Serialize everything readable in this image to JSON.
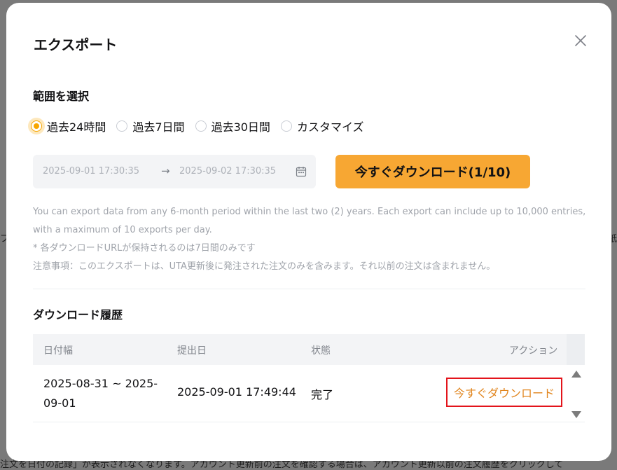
{
  "background": {
    "left_glyph": "フ",
    "right_glyph": "紙",
    "bottom_text": "注文を日付の記録」が表示されなくなります。アカウント更新前の注文を確認する場合は、アカウント更新以前の注文履歴をクリックして"
  },
  "modal": {
    "title": "エクスポート",
    "close_icon": "close-icon"
  },
  "range": {
    "label": "範囲を選択",
    "options": [
      {
        "label": "過去24時間",
        "checked": true
      },
      {
        "label": "過去7日間",
        "checked": false
      },
      {
        "label": "過去30日間",
        "checked": false
      },
      {
        "label": "カスタマイズ",
        "checked": false
      }
    ],
    "start": "2025-09-01 17:30:35",
    "arrow": "→",
    "end": "2025-09-02 17:30:35",
    "calendar_icon": "calendar-icon",
    "download_button": "今すぐダウンロード(1/10)"
  },
  "notes": [
    "You can export data from any 6-month period within the last two (2) years. Each export can include up to 10,000 entries,",
    "with a maximum of 10 exports per day.",
    "* 各ダウンロードURLが保持されるのは7日間のみです",
    "注意事項：このエクスポートは、UTA更新後に発注された注文のみを含みます。それ以前の注文は含まれません。"
  ],
  "history": {
    "label": "ダウンロード履歴",
    "columns": [
      "日付幅",
      "提出日",
      "状態",
      "アクション"
    ],
    "rows": [
      {
        "range_line1": "2025-08-31 ~ 2025-",
        "range_line2": "09-01",
        "submitted": "2025-09-01 17:49:44",
        "status": "完了",
        "action": "今すぐダウンロード"
      }
    ]
  },
  "colors": {
    "accent": "#f7a733",
    "link": "#e1861f",
    "highlight_border": "#e3141b"
  }
}
